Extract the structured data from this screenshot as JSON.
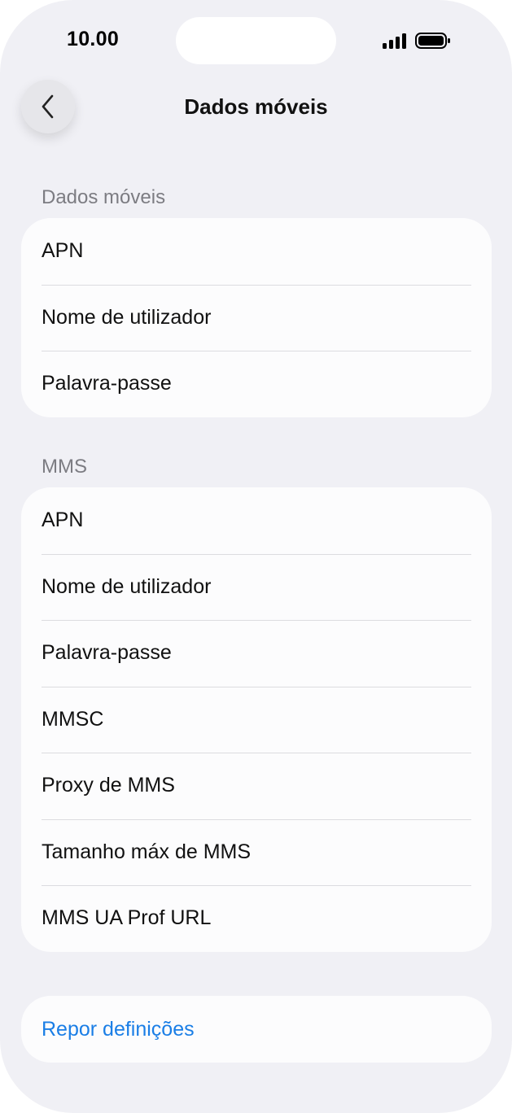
{
  "status_bar": {
    "time": "10.00"
  },
  "nav": {
    "title": "Dados móveis"
  },
  "sections": [
    {
      "header": "Dados móveis",
      "items": [
        {
          "label": "APN"
        },
        {
          "label": "Nome de utilizador"
        },
        {
          "label": "Palavra-passe"
        }
      ]
    },
    {
      "header": "MMS",
      "items": [
        {
          "label": "APN"
        },
        {
          "label": "Nome de utilizador"
        },
        {
          "label": "Palavra-passe"
        },
        {
          "label": "MMSC"
        },
        {
          "label": "Proxy de MMS"
        },
        {
          "label": "Tamanho máx de MMS"
        },
        {
          "label": "MMS UA Prof URL"
        }
      ]
    }
  ],
  "reset": {
    "label": "Repor definições"
  },
  "colors": {
    "background": "#f0f0f5",
    "card": "#fcfcfd",
    "link": "#1a7ee6",
    "section_header": "#7c7c82"
  }
}
